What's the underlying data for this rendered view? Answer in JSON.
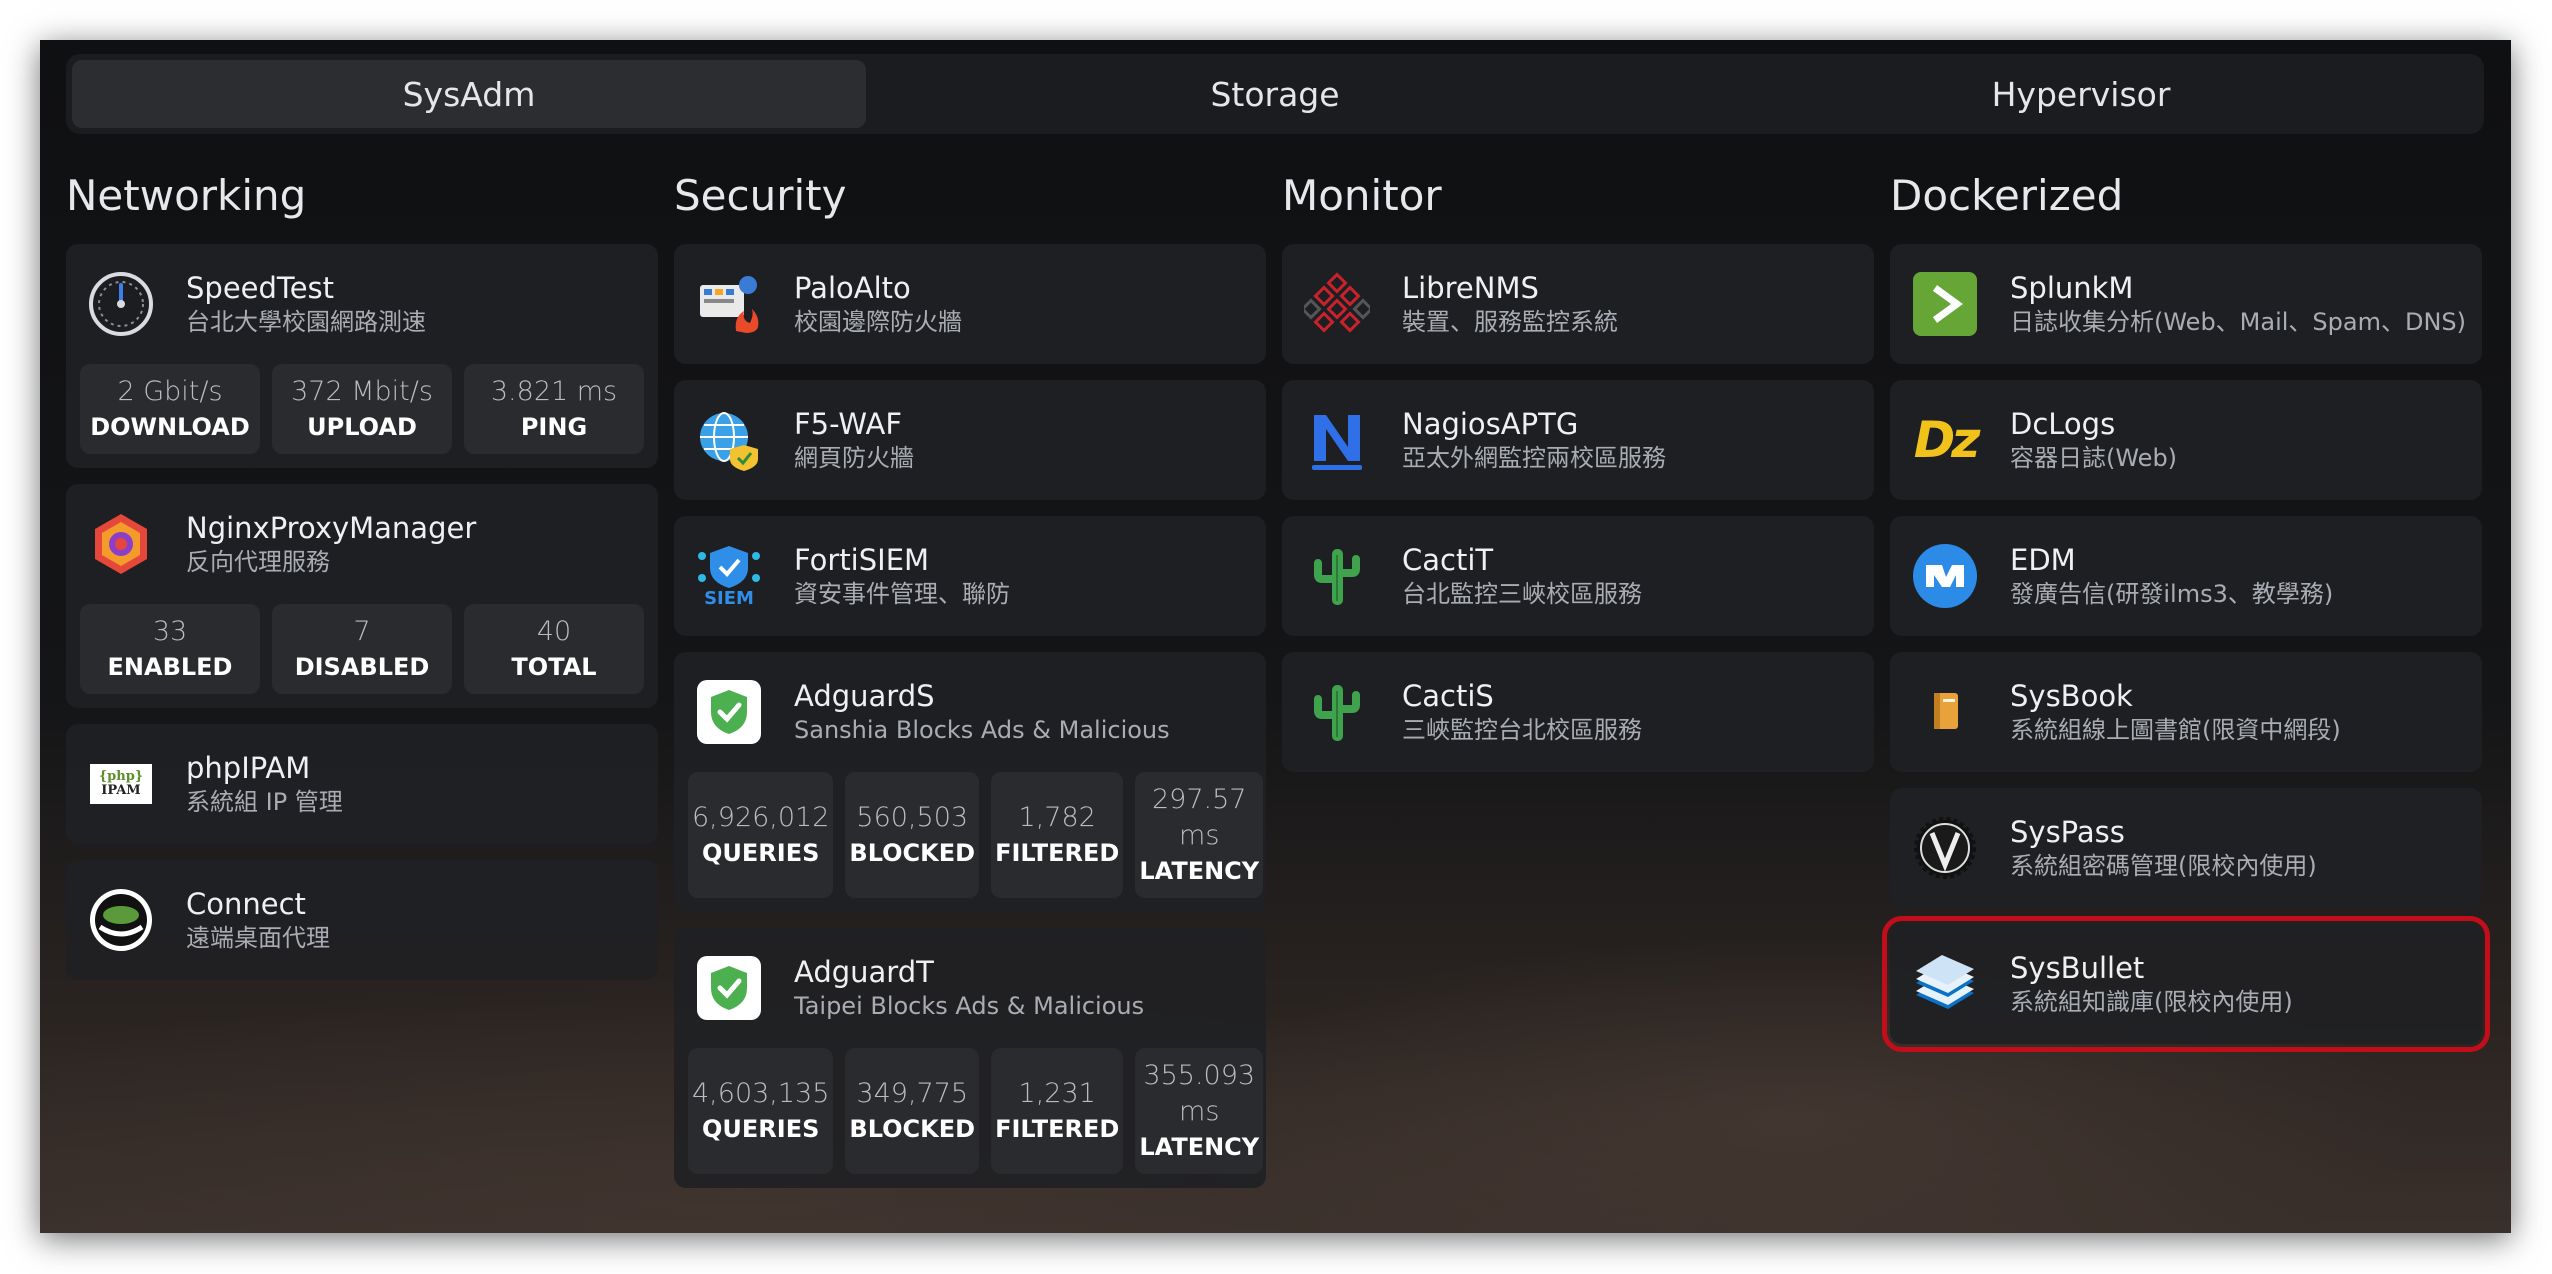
{
  "tabs": [
    "SysAdm",
    "Storage",
    "Hypervisor"
  ],
  "active_tab": "SysAdm",
  "columns": {
    "networking": {
      "title": "Networking",
      "services": [
        {
          "name": "SpeedTest",
          "desc": "台北大學校園網路測速",
          "icon": "speedometer-icon",
          "stats": [
            {
              "value": "2 Gbit/s",
              "label": "DOWNLOAD"
            },
            {
              "value": "372 Mbit/s",
              "label": "UPLOAD"
            },
            {
              "value": "3.821 ms",
              "label": "PING"
            }
          ]
        },
        {
          "name": "NginxProxyManager",
          "desc": "反向代理服務",
          "icon": "nginx-proxy-icon",
          "stats": [
            {
              "value": "33",
              "label": "ENABLED"
            },
            {
              "value": "7",
              "label": "DISABLED"
            },
            {
              "value": "40",
              "label": "TOTAL"
            }
          ]
        },
        {
          "name": "phpIPAM",
          "desc": "系統組 IP 管理",
          "icon": "phpipam-icon",
          "icon_text": [
            "{php}",
            "IPAM"
          ]
        },
        {
          "name": "Connect",
          "desc": "遠端桌面代理",
          "icon": "connect-icon"
        }
      ]
    },
    "security": {
      "title": "Security",
      "services": [
        {
          "name": "PaloAlto",
          "desc": "校園邊際防火牆",
          "icon": "firewall-icon"
        },
        {
          "name": "F5-WAF",
          "desc": "網頁防火牆",
          "icon": "globe-shield-icon"
        },
        {
          "name": "FortiSIEM",
          "desc": "資安事件管理、聯防",
          "icon": "siem-icon",
          "icon_text": "SIEM"
        },
        {
          "name": "AdguardS",
          "desc": "Sanshia Blocks Ads & Malicious",
          "icon": "adguard-icon",
          "stats": [
            {
              "value": "6,926,012",
              "label": "QUERIES"
            },
            {
              "value": "560,503",
              "label": "BLOCKED"
            },
            {
              "value": "1,782",
              "label": "FILTERED"
            },
            {
              "value": "297.57 ms",
              "label": "LATENCY"
            }
          ]
        },
        {
          "name": "AdguardT",
          "desc": "Taipei Blocks Ads & Malicious",
          "icon": "adguard-icon",
          "stats": [
            {
              "value": "4,603,135",
              "label": "QUERIES"
            },
            {
              "value": "349,775",
              "label": "BLOCKED"
            },
            {
              "value": "1,231",
              "label": "FILTERED"
            },
            {
              "value": "355.093 ms",
              "label": "LATENCY"
            }
          ]
        }
      ]
    },
    "monitor": {
      "title": "Monitor",
      "services": [
        {
          "name": "LibreNMS",
          "desc": "裝置、服務監控系統",
          "icon": "librenms-icon"
        },
        {
          "name": "NagiosAPTG",
          "desc": "亞太外網監控兩校區服務",
          "icon": "nagios-icon"
        },
        {
          "name": "CactiT",
          "desc": "台北監控三峽校區服務",
          "icon": "cactus-icon"
        },
        {
          "name": "CactiS",
          "desc": "三峽監控台北校區服務",
          "icon": "cactus-icon"
        }
      ]
    },
    "dockerized": {
      "title": "Dockerized",
      "services": [
        {
          "name": "SplunkM",
          "desc": "日誌收集分析(Web、Mail、Spam、DNS)",
          "icon": "splunk-icon"
        },
        {
          "name": "DcLogs",
          "desc": "容器日誌(Web)",
          "icon": "dozzle-icon",
          "icon_text": "Dz"
        },
        {
          "name": "EDM",
          "desc": "發廣告信(研發ilms3、教學務)",
          "icon": "mail-icon"
        },
        {
          "name": "SysBook",
          "desc": "系統組線上圖書館(限資中網段)",
          "icon": "book-icon"
        },
        {
          "name": "SysPass",
          "desc": "系統組密碼管理(限校內使用)",
          "icon": "syspass-icon"
        },
        {
          "name": "SysBullet",
          "desc": "系統組知識庫(限校內使用)",
          "icon": "bookstack-icon"
        }
      ]
    }
  },
  "colors": {
    "highlight": "#c40d1b",
    "splunk": "#65a637",
    "adguard": "#4caf50"
  }
}
